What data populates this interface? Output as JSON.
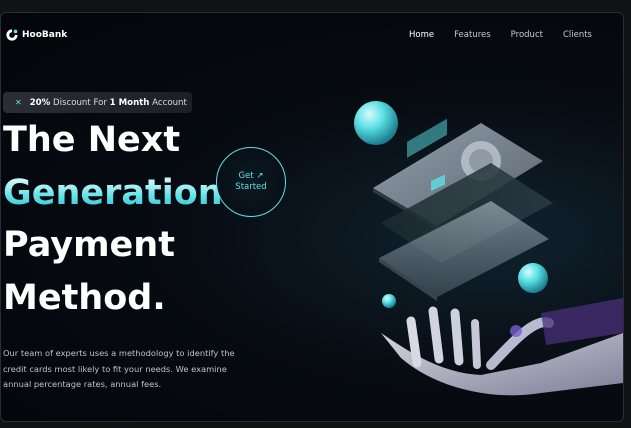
{
  "header": {
    "logo_text": "HooBank",
    "nav": [
      "Home",
      "Features",
      "Product",
      "Clients"
    ],
    "active_nav": "Home"
  },
  "promo": {
    "percent": "20%",
    "text_mid": " Discount For ",
    "strong": "1 Month",
    "text_end": " Account"
  },
  "hero": {
    "line1": "The Next",
    "line2": "Generation",
    "line3": "Payment",
    "line4": "Method.",
    "cta_line1": "Get ↗",
    "cta_line2": "Started",
    "description": "Our team of experts uses a methodology to identify the credit cards most likely to fit your needs. We examine annual percentage rates, annual fees."
  },
  "colors": {
    "accent": "#5ce1e6",
    "background": "#03050a",
    "text": "#ffffff"
  }
}
